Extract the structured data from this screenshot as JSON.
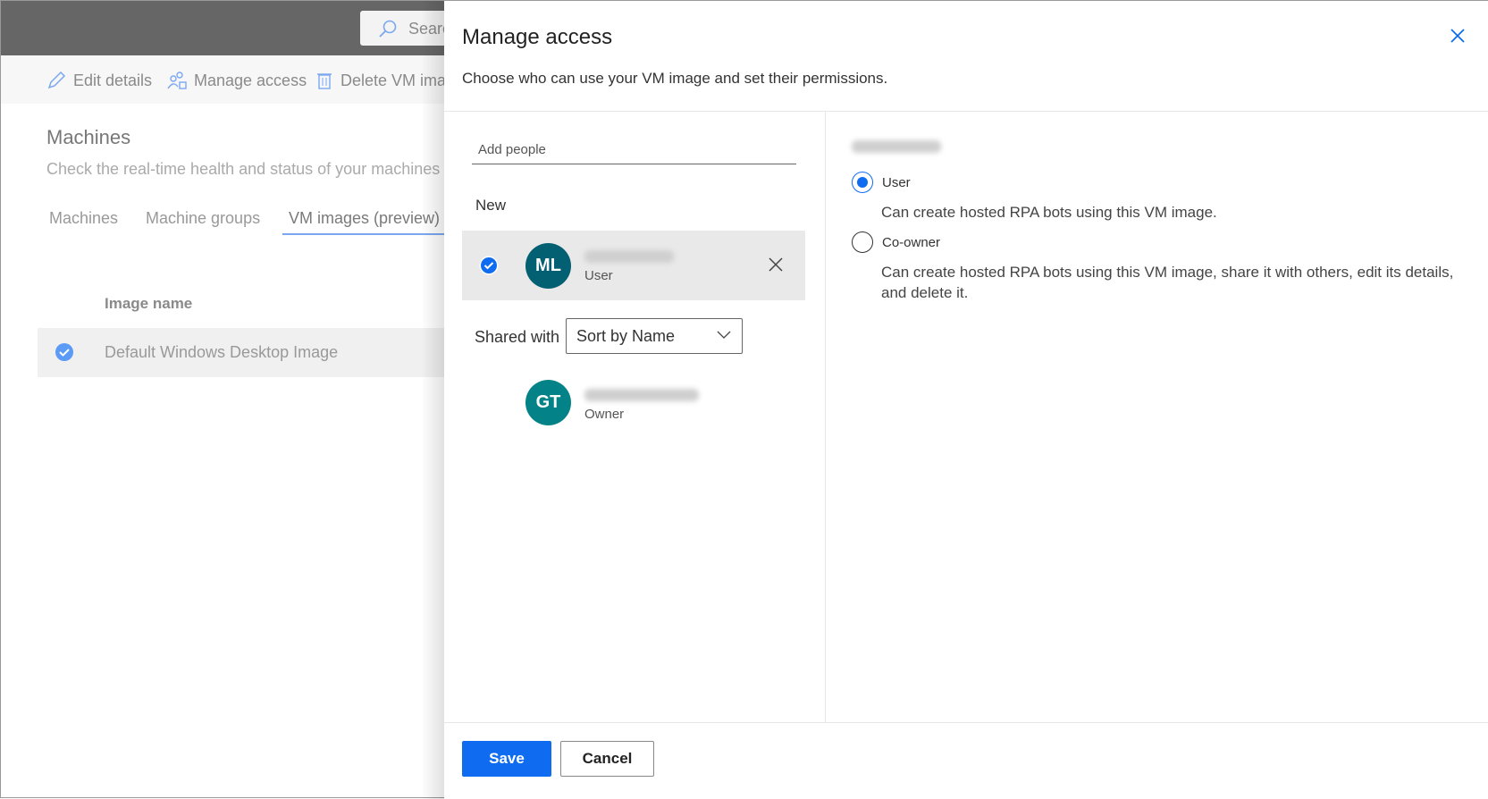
{
  "background": {
    "search_placeholder": "Search",
    "commands": [
      {
        "label": "Edit details",
        "icon": "pencil-icon"
      },
      {
        "label": "Manage access",
        "icon": "people-lock-icon"
      },
      {
        "label": "Delete VM image",
        "icon": "trash-icon"
      }
    ],
    "title": "Machines",
    "subtitle": "Check the real-time health and status of your machines and machine groups",
    "tabs": [
      "Machines",
      "Machine groups",
      "VM images (preview)"
    ],
    "column_header": "Image name",
    "rows": [
      "Default Windows Desktop Image"
    ]
  },
  "panel": {
    "title": "Manage access",
    "subtitle": "Choose who can use your VM image and set their permissions.",
    "add_people_placeholder": "Add people",
    "new_label": "New",
    "new_person": {
      "initials": "ML",
      "role": "User",
      "color": "#035f72"
    },
    "shared_with_label": "Shared with",
    "sort_value": "Sort by Name",
    "shared_person": {
      "initials": "GT",
      "role": "Owner",
      "color": "#038387"
    },
    "permissions": [
      {
        "label": "User",
        "description": "Can create hosted RPA bots using this VM image.",
        "selected": true
      },
      {
        "label": "Co-owner",
        "description": "Can create hosted RPA bots using this VM image, share it with others, edit its details, and delete it.",
        "selected": false
      }
    ],
    "save_label": "Save",
    "cancel_label": "Cancel"
  }
}
